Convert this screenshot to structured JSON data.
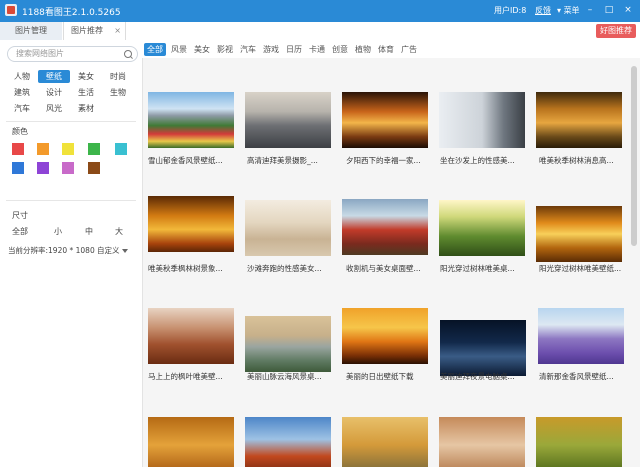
{
  "app": {
    "title": "1188看图王2.1.0.5265",
    "user_id": "用户ID:8",
    "feedback": "反馈",
    "menu": "菜单",
    "minimize": "–",
    "maximize": "□",
    "close": "×"
  },
  "tabs": [
    {
      "label": "图片管理"
    },
    {
      "label": "图片推荐",
      "close": "×"
    }
  ],
  "hot_button": "好图推荐",
  "sidebar": {
    "search_placeholder": "搜索网络图片",
    "categories": [
      {
        "label": "人物",
        "selected": false
      },
      {
        "label": "壁纸",
        "selected": true
      },
      {
        "label": "美女",
        "selected": false
      },
      {
        "label": "时尚",
        "selected": false
      },
      {
        "label": "建筑",
        "selected": false
      },
      {
        "label": "设计",
        "selected": false
      },
      {
        "label": "生活",
        "selected": false
      },
      {
        "label": "生物",
        "selected": false
      },
      {
        "label": "汽车",
        "selected": false
      },
      {
        "label": "风光",
        "selected": false
      },
      {
        "label": "素材",
        "selected": false
      }
    ],
    "color_label": "颜色",
    "colors": [
      "#e84848",
      "#f39a2b",
      "#f0e23a",
      "#3cb54a",
      "#39c0d1",
      "#2f78d8",
      "#8e44d6",
      "#c86ac9",
      "#8b4a17"
    ],
    "size_label": "尺寸",
    "sizes": [
      "全部",
      "小",
      "中",
      "大"
    ],
    "resolution": "当前分辨率:1920 * 1080",
    "custom": "自定义"
  },
  "filters": [
    "全部",
    "风景",
    "美女",
    "影视",
    "汽车",
    "游戏",
    "日历",
    "卡通",
    "创意",
    "植物",
    "体育",
    "广告"
  ],
  "grid": [
    {
      "caption": "雪山郁金香风景壁纸...",
      "img": "tulips-mountain"
    },
    {
      "caption": "高清迪拜美景摄影_...",
      "img": "dubai-aerial"
    },
    {
      "caption": "夕阳西下的幸福一家...",
      "img": "sunset-family"
    },
    {
      "caption": "坐在沙发上的性感美...",
      "img": "woman-on-sofa"
    },
    {
      "caption": "唯美秋季树林消息高...",
      "img": "autumn-stream"
    },
    {
      "caption": "唯美秋季枫林树景象...",
      "img": "maple-forest"
    },
    {
      "caption": "沙滩奔跑的性感美女...",
      "img": "beach-running"
    },
    {
      "caption": "收割机与美女桌面壁...",
      "img": "harvester-woman"
    },
    {
      "caption": "阳光穿过树林唯美桌...",
      "img": "sunlit-forest"
    },
    {
      "caption": "阳光穿过树林唯美壁纸...",
      "img": "sun-through-trees"
    },
    {
      "caption": "马上上的枫叶唯美壁...",
      "img": "maple-road"
    },
    {
      "caption": "美丽山脉云海风景桌...",
      "img": "mountain-clouds"
    },
    {
      "caption": "美丽的日出壁纸下载",
      "img": "palm-sunrise"
    },
    {
      "caption": "美丽迪拜夜景电脑桌...",
      "img": "dubai-night"
    },
    {
      "caption": "清新那金香风景壁纸...",
      "img": "lavender-field"
    },
    {
      "caption": "",
      "img": "golden-waves"
    },
    {
      "caption": "",
      "img": "golden-gate"
    },
    {
      "caption": "",
      "img": "autumn-park"
    },
    {
      "caption": "",
      "img": "tile-wall"
    },
    {
      "caption": "",
      "img": "tree-tunnel"
    }
  ]
}
